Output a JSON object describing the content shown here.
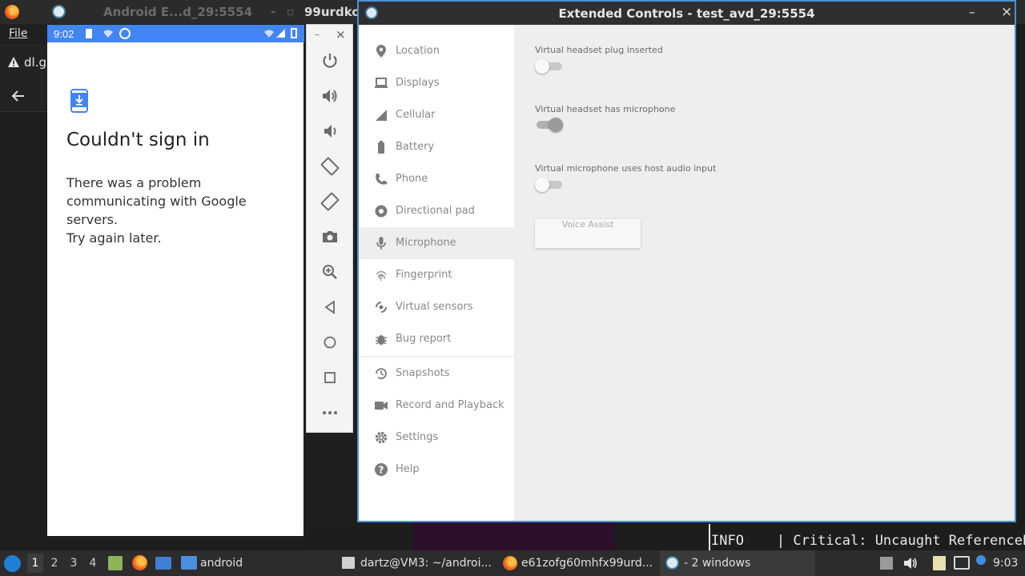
{
  "background_window": {
    "title": "Android E...d_29:5554",
    "other_title": "99urdko",
    "menu_label": "File",
    "tab_label": "dl.g"
  },
  "terminal": {
    "info_line": "INFO    | Critical: Uncaught ReferenceE"
  },
  "phone": {
    "status_time": "9:02",
    "heading": "Couldn't sign in",
    "message": "There was a problem communicating with Google servers.",
    "retry": "Try again later."
  },
  "emulator_toolbar": {
    "minimize": "–",
    "close": "×",
    "buttons": [
      "power-icon",
      "volume-up-icon",
      "volume-down-icon",
      "rotate-left-icon",
      "rotate-right-icon",
      "camera-icon",
      "zoom-icon",
      "back-icon",
      "home-icon",
      "overview-icon",
      "more-icon"
    ]
  },
  "extended_controls": {
    "title": "Extended Controls - test_avd_29:5554",
    "minimize": "–",
    "close": "×",
    "nav": [
      {
        "label": "Location",
        "icon": "location-pin-icon"
      },
      {
        "label": "Displays",
        "icon": "display-icon"
      },
      {
        "label": "Cellular",
        "icon": "signal-icon"
      },
      {
        "label": "Battery",
        "icon": "battery-icon"
      },
      {
        "label": "Phone",
        "icon": "phone-icon"
      },
      {
        "label": "Directional pad",
        "icon": "dpad-icon"
      },
      {
        "label": "Microphone",
        "icon": "microphone-icon",
        "selected": true
      },
      {
        "label": "Fingerprint",
        "icon": "fingerprint-icon"
      },
      {
        "label": "Virtual sensors",
        "icon": "sensors-icon"
      },
      {
        "label": "Bug report",
        "icon": "bug-icon"
      },
      {
        "label": "Snapshots",
        "icon": "history-icon"
      },
      {
        "label": "Record and Playback",
        "icon": "video-camera-icon"
      },
      {
        "label": "Settings",
        "icon": "gear-icon"
      },
      {
        "label": "Help",
        "icon": "help-icon"
      }
    ],
    "options": [
      {
        "label": "Virtual headset plug inserted",
        "checked": false
      },
      {
        "label": "Virtual headset has microphone",
        "checked": true
      },
      {
        "label": "Virtual microphone uses host audio input",
        "checked": false
      }
    ],
    "voice_assist_label": "Voice Assist"
  },
  "taskbar": {
    "workspaces": [
      "1",
      "2",
      "3",
      "4"
    ],
    "active_workspace": "1",
    "tasks": {
      "folder": "android",
      "terminal": "dartz@VM3: ~/androi...",
      "browser": "e61zofg60mhfx99urd...",
      "emulator": "- 2 windows"
    },
    "clock": "9:03"
  }
}
